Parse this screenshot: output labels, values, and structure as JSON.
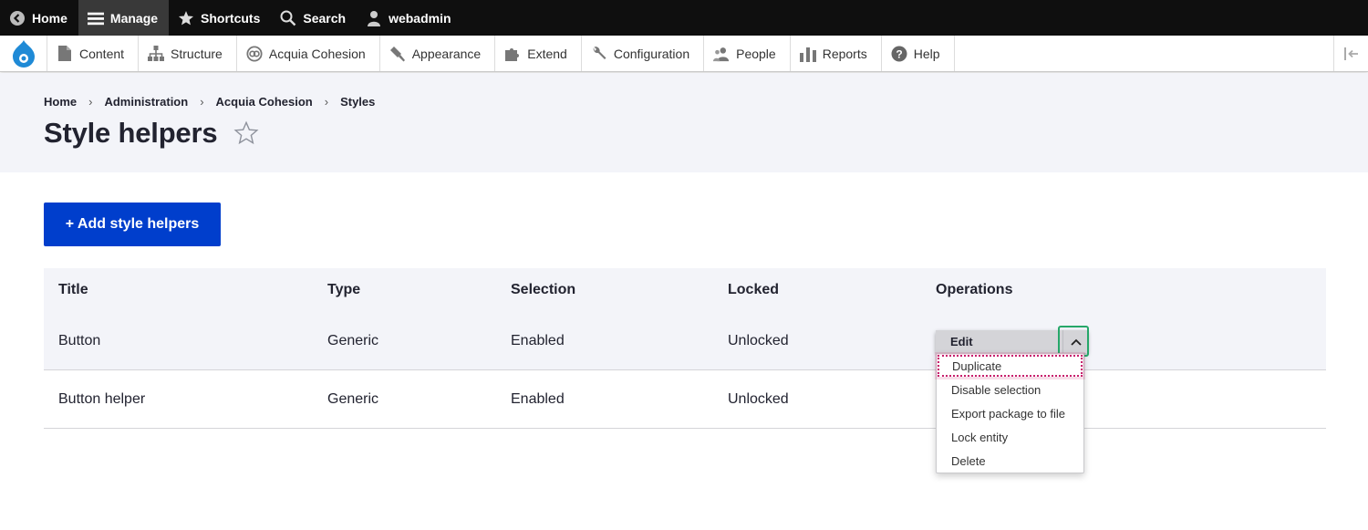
{
  "toolbar": {
    "items": [
      {
        "label": "Home",
        "icon": "back-circle-icon"
      },
      {
        "label": "Manage",
        "icon": "hamburger-menu-icon"
      },
      {
        "label": "Shortcuts",
        "icon": "star-icon"
      },
      {
        "label": "Search",
        "icon": "search-icon"
      },
      {
        "label": "webadmin",
        "icon": "user-icon"
      }
    ]
  },
  "tray": {
    "items": [
      {
        "label": "Content",
        "icon": "file-icon"
      },
      {
        "label": "Structure",
        "icon": "sitemap-icon"
      },
      {
        "label": "Acquia Cohesion",
        "icon": "cohesion-icon"
      },
      {
        "label": "Appearance",
        "icon": "paintbrush-icon"
      },
      {
        "label": "Extend",
        "icon": "puzzle-icon"
      },
      {
        "label": "Configuration",
        "icon": "wrench-icon"
      },
      {
        "label": "People",
        "icon": "people-icon"
      },
      {
        "label": "Reports",
        "icon": "bar-chart-icon"
      },
      {
        "label": "Help",
        "icon": "help-icon"
      }
    ]
  },
  "breadcrumb": [
    "Home",
    "Administration",
    "Acquia Cohesion",
    "Styles"
  ],
  "page": {
    "title": "Style helpers",
    "add_button": "+ Add style helpers"
  },
  "table": {
    "headers": [
      "Title",
      "Type",
      "Selection",
      "Locked",
      "Operations"
    ],
    "rows": [
      {
        "title": "Button",
        "type": "Generic",
        "selection": "Enabled",
        "locked": "Unlocked"
      },
      {
        "title": "Button helper",
        "type": "Generic",
        "selection": "Enabled",
        "locked": "Unlocked"
      }
    ]
  },
  "operations": {
    "edit_label": "Edit",
    "menu": [
      "Duplicate",
      "Disable selection",
      "Export package to file",
      "Lock entity",
      "Delete"
    ]
  },
  "colors": {
    "toolbar_bg": "#0f0f0f",
    "header_bg": "#f3f4f9",
    "primary_button": "#003ecc",
    "focus_green": "#26a769",
    "focus_pink": "#c71f6d"
  }
}
